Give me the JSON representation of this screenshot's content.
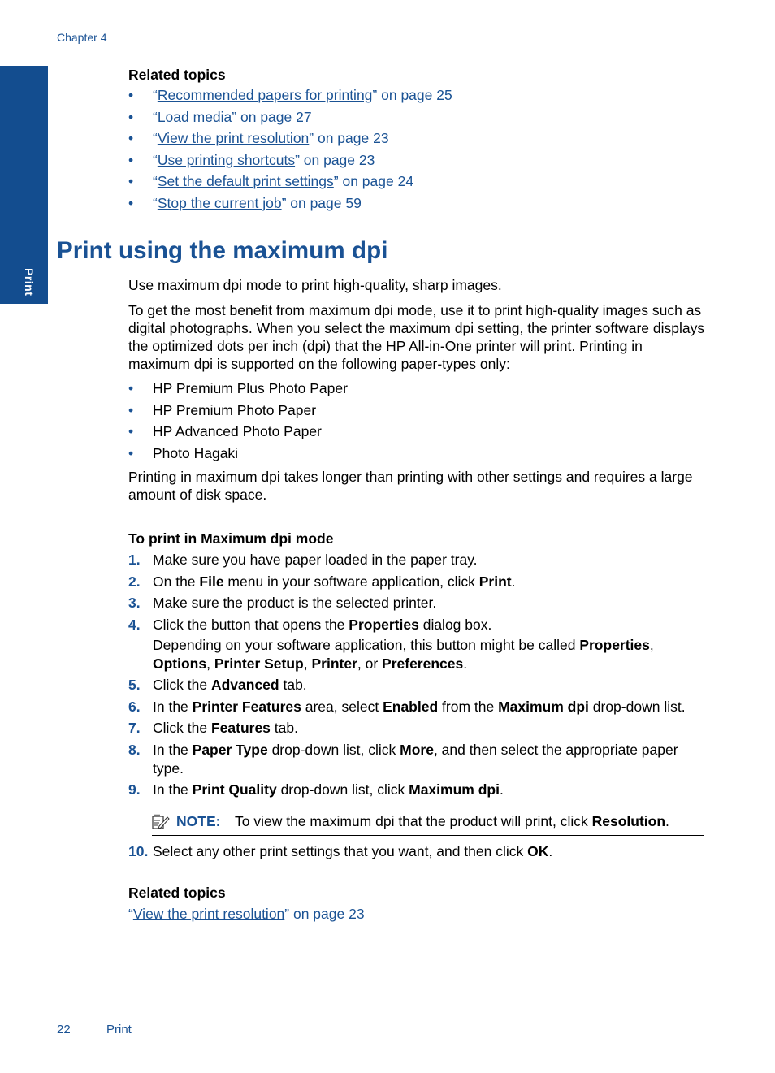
{
  "header": {
    "chapter": "Chapter 4"
  },
  "side_tab": {
    "label": "Print",
    "color": "#134d8f"
  },
  "related_top": {
    "heading": "Related topics",
    "links": [
      {
        "open_quote": "“",
        "title": "Recommended papers for printing",
        "suffix": "” on page 25"
      },
      {
        "open_quote": "“",
        "title": "Load media",
        "suffix": "” on page 27"
      },
      {
        "open_quote": "“",
        "title": "View the print resolution",
        "suffix": "” on page 23"
      },
      {
        "open_quote": "“",
        "title": "Use printing shortcuts",
        "suffix": "” on page 23"
      },
      {
        "open_quote": "“",
        "title": "Set the default print settings",
        "suffix": "” on page 24"
      },
      {
        "open_quote": "“",
        "title": "Stop the current job",
        "suffix": "” on page 59"
      }
    ]
  },
  "section": {
    "title": "Print using the maximum dpi",
    "intro": "Use maximum dpi mode to print high-quality, sharp images.",
    "para2": "To get the most benefit from maximum dpi mode, use it to print high-quality images such as digital photographs. When you select the maximum dpi setting, the printer software displays the optimized dots per inch (dpi) that the HP All-in-One printer will print. Printing in maximum dpi is supported on the following paper-types only:",
    "paper_types": [
      "HP Premium Plus Photo Paper",
      "HP Premium Photo Paper",
      "HP Advanced Photo Paper",
      "Photo Hagaki"
    ],
    "para3": "Printing in maximum dpi takes longer than printing with other settings and requires a large amount of disk space.",
    "procedure_heading": "To print in Maximum dpi mode",
    "steps": {
      "s1": {
        "num": "1.",
        "text": "Make sure you have paper loaded in the paper tray."
      },
      "s2": {
        "num": "2.",
        "a": "On the ",
        "b1": "File",
        "c": " menu in your software application, click ",
        "b2": "Print",
        "d": "."
      },
      "s3": {
        "num": "3.",
        "text": "Make sure the product is the selected printer."
      },
      "s4": {
        "num": "4.",
        "a": "Click the button that opens the ",
        "b1": "Properties",
        "c": " dialog box.",
        "sub_a": "Depending on your software application, this button might be called ",
        "sub_b1": "Properties",
        "sub_c": ", ",
        "sub_b2": "Options",
        "sub_d": ", ",
        "sub_b3": "Printer Setup",
        "sub_e": ", ",
        "sub_b4": "Printer",
        "sub_f": ", or ",
        "sub_b5": "Preferences",
        "sub_g": "."
      },
      "s5": {
        "num": "5.",
        "a": "Click the ",
        "b1": "Advanced",
        "c": " tab."
      },
      "s6": {
        "num": "6.",
        "a": "In the ",
        "b1": "Printer Features",
        "c": " area, select ",
        "b2": "Enabled",
        "d": " from the ",
        "b3": "Maximum dpi",
        "e": " drop-down list."
      },
      "s7": {
        "num": "7.",
        "a": "Click the ",
        "b1": "Features",
        "c": " tab."
      },
      "s8": {
        "num": "8.",
        "a": "In the ",
        "b1": "Paper Type",
        "c": " drop-down list, click ",
        "b2": "More",
        "d": ", and then select the appropriate paper type."
      },
      "s9": {
        "num": "9.",
        "a": "In the ",
        "b1": "Print Quality",
        "c": " drop-down list, click ",
        "b2": "Maximum dpi",
        "d": "."
      },
      "s10": {
        "num": "10.",
        "a": "Select any other print settings that you want, and then click ",
        "b1": "OK",
        "d": "."
      }
    },
    "note": {
      "label": "NOTE:",
      "text_a": "To view the maximum dpi that the product will print, click ",
      "text_b": "Resolution",
      "text_c": "."
    }
  },
  "related_bottom": {
    "heading": "Related topics",
    "link": {
      "open_quote": "“",
      "title": "View the print resolution",
      "suffix": "” on page 23"
    }
  },
  "footer": {
    "page_number": "22",
    "section": "Print"
  }
}
